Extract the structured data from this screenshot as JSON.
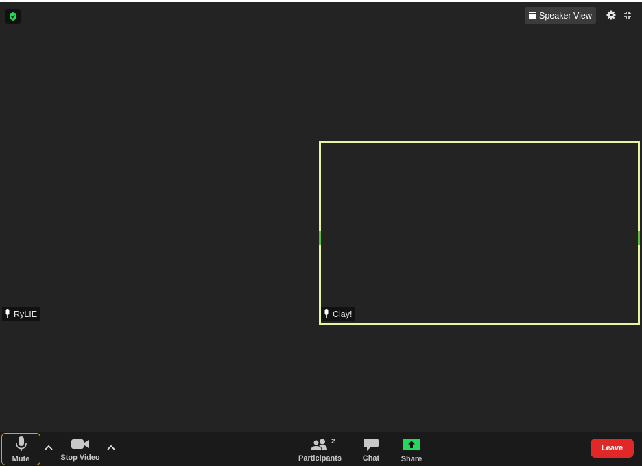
{
  "header": {
    "view_label": "Speaker View",
    "icons": [
      "shield-check-icon",
      "grid-icon",
      "gear-icon",
      "fullscreen-icon"
    ]
  },
  "participants": [
    {
      "name": "RyLIE",
      "active": false
    },
    {
      "name": "Clay!",
      "active": true
    }
  ],
  "toolbar": {
    "mute_label": "Mute",
    "video_label": "Stop Video",
    "participants_label": "Participants",
    "participants_count": "2",
    "chat_label": "Chat",
    "share_label": "Share",
    "leave_label": "Leave"
  },
  "colors": {
    "background": "#232323",
    "toolbar": "#1a1a1a",
    "active_border": "#e8f49e",
    "shield": "#23d959",
    "share": "#23d959",
    "leave": "#e02828",
    "mute_outline": "#d9a21c"
  }
}
